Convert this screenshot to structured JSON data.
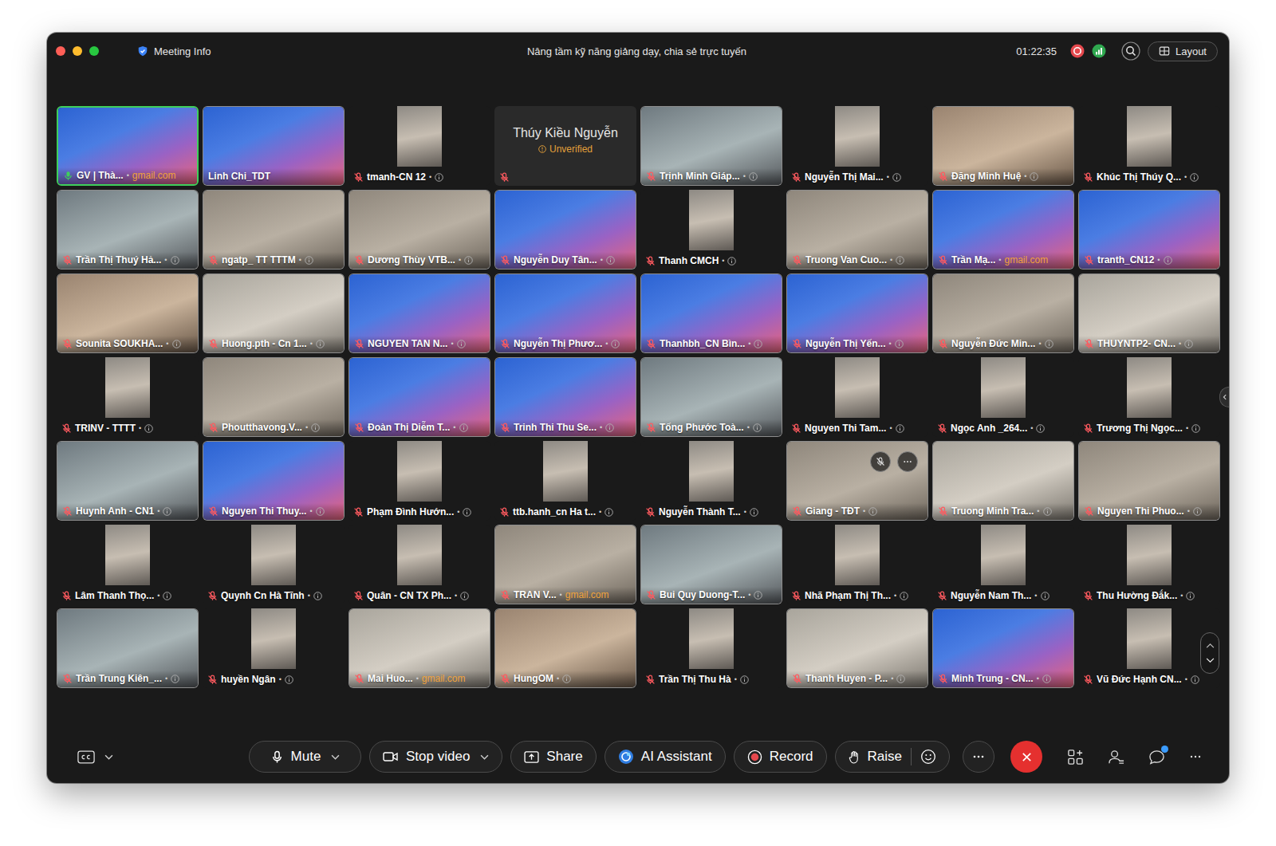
{
  "window": {
    "title": "Nâng tầm kỹ năng giảng dạy, chia sẻ trực tuyến",
    "meeting_info": "Meeting Info",
    "timer": "01:22:35",
    "recording": true,
    "layout_button": "Layout"
  },
  "grid": {
    "separator": "•",
    "participants": [
      {
        "name": "GV | Thà...",
        "view": "branded",
        "muted": false,
        "speaking": true,
        "hovered": false,
        "info": false,
        "email": "gmail.com",
        "status": ""
      },
      {
        "name": "Linh Chi_TDT",
        "view": "branded",
        "muted": false,
        "speaking": false,
        "hovered": false,
        "info": false,
        "email": "",
        "status": ""
      },
      {
        "name": "tmanh-CN 12",
        "view": "portrait",
        "muted": true,
        "speaking": false,
        "hovered": false,
        "info": true,
        "email": "",
        "status": ""
      },
      {
        "name": "Thúy Kiều Nguyễn",
        "view": "off",
        "muted": true,
        "speaking": false,
        "hovered": false,
        "info": false,
        "email": "",
        "status": "Unverified"
      },
      {
        "name": "Trịnh Minh Giáp...",
        "view": "camera",
        "muted": true,
        "speaking": false,
        "hovered": false,
        "info": true,
        "email": "",
        "status": ""
      },
      {
        "name": "Nguyễn Thị Mai...",
        "view": "portrait",
        "muted": true,
        "speaking": false,
        "hovered": false,
        "info": true,
        "email": "",
        "status": ""
      },
      {
        "name": "Đặng Minh Huệ",
        "view": "camera",
        "muted": true,
        "speaking": false,
        "hovered": false,
        "info": true,
        "email": "",
        "status": ""
      },
      {
        "name": "Khúc Thị Thúy Q...",
        "view": "portrait",
        "muted": true,
        "speaking": false,
        "hovered": false,
        "info": true,
        "email": "",
        "status": ""
      },
      {
        "name": "Trần Thị Thuý Hả...",
        "view": "camera",
        "muted": true,
        "speaking": false,
        "hovered": false,
        "info": true,
        "email": "",
        "status": ""
      },
      {
        "name": "ngatp_ TT TTTM",
        "view": "camera",
        "muted": true,
        "speaking": false,
        "hovered": false,
        "info": true,
        "email": "",
        "status": ""
      },
      {
        "name": "Dương Thùy VTB...",
        "view": "camera",
        "muted": true,
        "speaking": false,
        "hovered": false,
        "info": true,
        "email": "",
        "status": ""
      },
      {
        "name": "Nguyễn Duy Tân...",
        "view": "branded",
        "muted": true,
        "speaking": false,
        "hovered": false,
        "info": true,
        "email": "",
        "status": ""
      },
      {
        "name": "Thanh CMCH",
        "view": "portrait",
        "muted": true,
        "speaking": false,
        "hovered": false,
        "info": true,
        "email": "",
        "status": ""
      },
      {
        "name": "Truong Van Cuo...",
        "view": "camera",
        "muted": true,
        "speaking": false,
        "hovered": false,
        "info": true,
        "email": "",
        "status": ""
      },
      {
        "name": "Trần Mạ...",
        "view": "branded",
        "muted": true,
        "speaking": false,
        "hovered": false,
        "info": false,
        "email": "gmail.com",
        "status": ""
      },
      {
        "name": "tranth_CN12",
        "view": "branded",
        "muted": true,
        "speaking": false,
        "hovered": false,
        "info": true,
        "email": "",
        "status": ""
      },
      {
        "name": "Sounita SOUKHA...",
        "view": "camera",
        "muted": true,
        "speaking": false,
        "hovered": false,
        "info": true,
        "email": "",
        "status": ""
      },
      {
        "name": "Huong.pth - Cn 1...",
        "view": "camera",
        "muted": true,
        "speaking": false,
        "hovered": false,
        "info": true,
        "email": "",
        "status": ""
      },
      {
        "name": "NGUYEN TAN N...",
        "view": "branded",
        "muted": true,
        "speaking": false,
        "hovered": false,
        "info": true,
        "email": "",
        "status": ""
      },
      {
        "name": "Nguyễn Thị Phươ...",
        "view": "branded",
        "muted": true,
        "speaking": false,
        "hovered": false,
        "info": true,
        "email": "",
        "status": ""
      },
      {
        "name": "Thanhbh_CN Bìn...",
        "view": "branded",
        "muted": true,
        "speaking": false,
        "hovered": false,
        "info": true,
        "email": "",
        "status": ""
      },
      {
        "name": "Nguyễn Thị Yến...",
        "view": "branded",
        "muted": true,
        "speaking": false,
        "hovered": false,
        "info": true,
        "email": "",
        "status": ""
      },
      {
        "name": "Nguyễn Đức Min...",
        "view": "camera",
        "muted": true,
        "speaking": false,
        "hovered": false,
        "info": true,
        "email": "",
        "status": ""
      },
      {
        "name": "THUYNTP2- CN...",
        "view": "camera",
        "muted": true,
        "speaking": false,
        "hovered": false,
        "info": true,
        "email": "",
        "status": ""
      },
      {
        "name": "TRINV - TTTT",
        "view": "portrait",
        "muted": true,
        "speaking": false,
        "hovered": false,
        "info": true,
        "email": "",
        "status": ""
      },
      {
        "name": "Phoutthavong.V...",
        "view": "camera",
        "muted": true,
        "speaking": false,
        "hovered": false,
        "info": true,
        "email": "",
        "status": ""
      },
      {
        "name": "Đoàn Thị Diễm T...",
        "view": "branded",
        "muted": true,
        "speaking": false,
        "hovered": false,
        "info": true,
        "email": "",
        "status": ""
      },
      {
        "name": "Trinh Thi Thu Se...",
        "view": "branded",
        "muted": true,
        "speaking": false,
        "hovered": false,
        "info": true,
        "email": "",
        "status": ""
      },
      {
        "name": "Tống Phước Toà...",
        "view": "camera",
        "muted": true,
        "speaking": false,
        "hovered": false,
        "info": true,
        "email": "",
        "status": ""
      },
      {
        "name": "Nguyen Thi Tam...",
        "view": "portrait",
        "muted": true,
        "speaking": false,
        "hovered": false,
        "info": true,
        "email": "",
        "status": ""
      },
      {
        "name": "Ngọc Anh _264...",
        "view": "portrait",
        "muted": true,
        "speaking": false,
        "hovered": false,
        "info": true,
        "email": "",
        "status": ""
      },
      {
        "name": "Trương Thị Ngọc...",
        "view": "portrait",
        "muted": true,
        "speaking": false,
        "hovered": false,
        "info": true,
        "email": "",
        "status": ""
      },
      {
        "name": "Huynh Anh - CN1",
        "view": "camera",
        "muted": true,
        "speaking": false,
        "hovered": false,
        "info": true,
        "email": "",
        "status": ""
      },
      {
        "name": "Nguyen Thi Thuy...",
        "view": "branded",
        "muted": true,
        "speaking": false,
        "hovered": false,
        "info": true,
        "email": "",
        "status": ""
      },
      {
        "name": "Phạm Đình Hướn...",
        "view": "portrait",
        "muted": true,
        "speaking": false,
        "hovered": false,
        "info": true,
        "email": "",
        "status": ""
      },
      {
        "name": "ttb.hanh_cn Ha t...",
        "view": "portrait",
        "muted": true,
        "speaking": false,
        "hovered": false,
        "info": true,
        "email": "",
        "status": ""
      },
      {
        "name": "Nguyễn Thành T...",
        "view": "portrait",
        "muted": true,
        "speaking": false,
        "hovered": false,
        "info": true,
        "email": "",
        "status": ""
      },
      {
        "name": "Giang - TĐT",
        "view": "camera",
        "muted": true,
        "speaking": false,
        "hovered": true,
        "info": true,
        "email": "",
        "status": ""
      },
      {
        "name": "Truong Minh Tra...",
        "view": "camera",
        "muted": true,
        "speaking": false,
        "hovered": false,
        "info": true,
        "email": "",
        "status": ""
      },
      {
        "name": "Nguyen Thi Phuo...",
        "view": "camera",
        "muted": true,
        "speaking": false,
        "hovered": false,
        "info": true,
        "email": "",
        "status": ""
      },
      {
        "name": "Lâm Thanh Thọ...",
        "view": "portrait",
        "muted": true,
        "speaking": false,
        "hovered": false,
        "info": true,
        "email": "",
        "status": ""
      },
      {
        "name": "Quynh Cn Hà Tĩnh",
        "view": "portrait",
        "muted": true,
        "speaking": false,
        "hovered": false,
        "info": true,
        "email": "",
        "status": ""
      },
      {
        "name": "Quân - CN TX Ph...",
        "view": "portrait",
        "muted": true,
        "speaking": false,
        "hovered": false,
        "info": true,
        "email": "",
        "status": ""
      },
      {
        "name": "TRAN V...",
        "view": "camera",
        "muted": true,
        "speaking": false,
        "hovered": false,
        "info": false,
        "email": "gmail.com",
        "status": ""
      },
      {
        "name": "Bui Quy Duong-T...",
        "view": "camera",
        "muted": true,
        "speaking": false,
        "hovered": false,
        "info": true,
        "email": "",
        "status": ""
      },
      {
        "name": "Nhã Phạm Thị Th...",
        "view": "portrait",
        "muted": true,
        "speaking": false,
        "hovered": false,
        "info": true,
        "email": "",
        "status": ""
      },
      {
        "name": "Nguyễn Nam Th...",
        "view": "portrait",
        "muted": true,
        "speaking": false,
        "hovered": false,
        "info": true,
        "email": "",
        "status": ""
      },
      {
        "name": "Thu Hường Đắk...",
        "view": "portrait",
        "muted": true,
        "speaking": false,
        "hovered": false,
        "info": true,
        "email": "",
        "status": ""
      },
      {
        "name": "Trần Trung Kiên_...",
        "view": "camera",
        "muted": true,
        "speaking": false,
        "hovered": false,
        "info": true,
        "email": "",
        "status": ""
      },
      {
        "name": "huyền Ngân",
        "view": "portrait",
        "muted": true,
        "speaking": false,
        "hovered": false,
        "info": true,
        "email": "",
        "status": ""
      },
      {
        "name": "Mai Huo...",
        "view": "camera",
        "muted": true,
        "speaking": false,
        "hovered": false,
        "info": false,
        "email": "gmail.com",
        "status": ""
      },
      {
        "name": "HungOM",
        "view": "camera",
        "muted": true,
        "speaking": false,
        "hovered": false,
        "info": true,
        "email": "",
        "status": ""
      },
      {
        "name": "Trần Thị Thu Hà",
        "view": "portrait",
        "muted": true,
        "speaking": false,
        "hovered": false,
        "info": true,
        "email": "",
        "status": ""
      },
      {
        "name": "Thanh Huyen - P...",
        "view": "camera",
        "muted": true,
        "speaking": false,
        "hovered": false,
        "info": true,
        "email": "",
        "status": ""
      },
      {
        "name": "Minh Trung - CN...",
        "view": "branded",
        "muted": true,
        "speaking": false,
        "hovered": false,
        "info": true,
        "email": "",
        "status": ""
      },
      {
        "name": "Vũ Đức Hạnh CN...",
        "view": "portrait",
        "muted": true,
        "speaking": false,
        "hovered": false,
        "info": true,
        "email": "",
        "status": ""
      }
    ]
  },
  "toolbar": {
    "buttons": [
      {
        "label": "Mute",
        "kind": "mute",
        "menu": true
      },
      {
        "label": "Stop video",
        "kind": "video",
        "menu": true
      },
      {
        "label": "Share",
        "kind": "share",
        "menu": false
      },
      {
        "label": "AI Assistant",
        "kind": "ai",
        "menu": false
      },
      {
        "label": "Record",
        "kind": "record",
        "menu": false
      },
      {
        "label": "Raise",
        "kind": "raise",
        "menu": false
      }
    ],
    "chat_unread": true
  }
}
